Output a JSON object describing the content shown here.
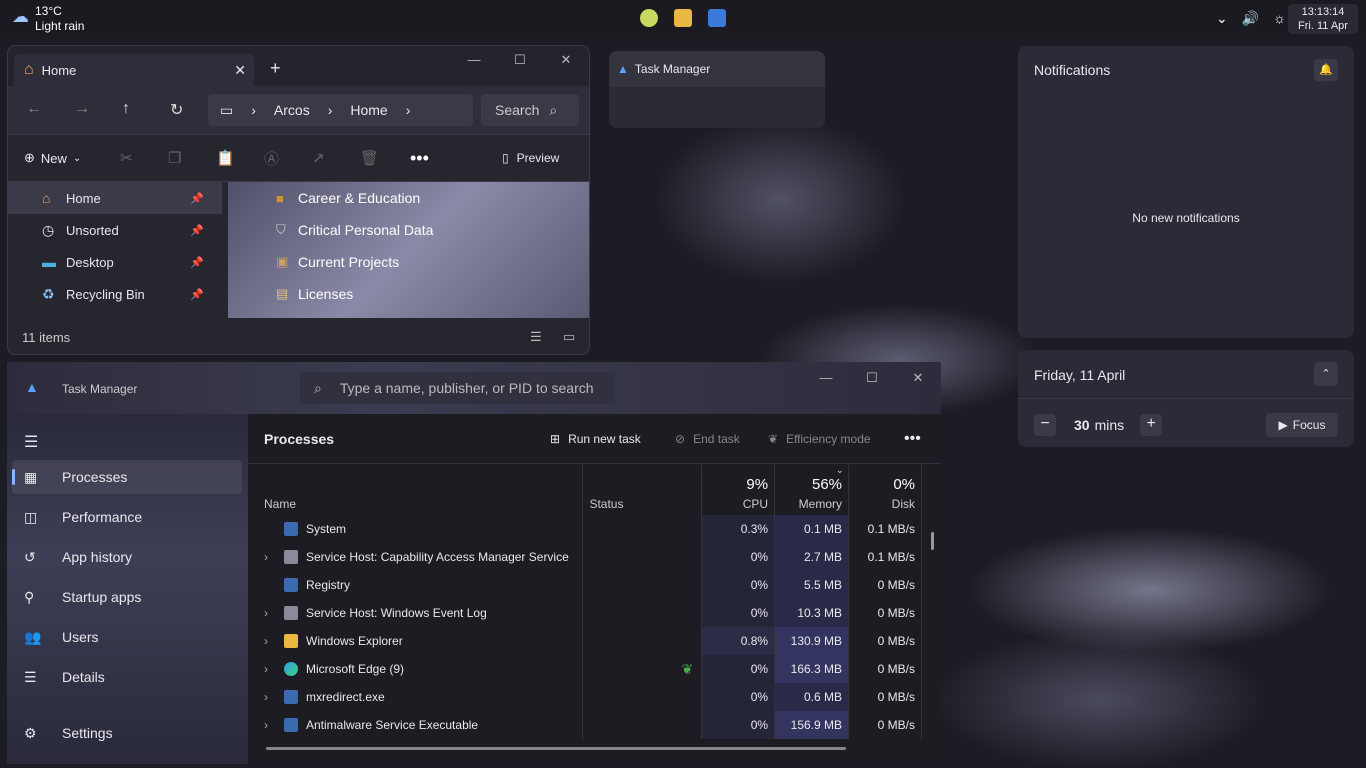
{
  "taskbar": {
    "weather_temp": "13°C",
    "weather_desc": "Light rain",
    "time": "13:13:14",
    "date": "Fri. 11 Apr"
  },
  "explorer": {
    "tab_title": "Home",
    "breadcrumb": [
      "Arcos",
      "Home"
    ],
    "search_placeholder": "Search",
    "new_label": "New",
    "preview_label": "Preview",
    "sidebar": [
      {
        "label": "Home",
        "icon": "home-icon"
      },
      {
        "label": "Unsorted",
        "icon": "clock-icon"
      },
      {
        "label": "Desktop",
        "icon": "desktop-icon"
      },
      {
        "label": "Recycling Bin",
        "icon": "recycle-bin-icon"
      }
    ],
    "folders": [
      {
        "label": "Career & Education",
        "icon": "briefcase-icon"
      },
      {
        "label": "Critical Personal Data",
        "icon": "shield-icon"
      },
      {
        "label": "Current Projects",
        "icon": "box-icon"
      },
      {
        "label": "Licenses",
        "icon": "certificate-icon"
      }
    ],
    "status": "11 items"
  },
  "tm_popup": {
    "title": "Task Manager"
  },
  "notifications": {
    "title": "Notifications",
    "empty": "No new notifications"
  },
  "calendar": {
    "date": "Friday, 11 April",
    "focus_value": "30",
    "focus_unit": "mins",
    "focus_label": "Focus"
  },
  "taskmgr": {
    "title": "Task Manager",
    "search_placeholder": "Type a name, publisher, or PID to search",
    "nav": [
      "Processes",
      "Performance",
      "App history",
      "Startup apps",
      "Users",
      "Details",
      "Settings"
    ],
    "page_title": "Processes",
    "run_new_task": "Run new task",
    "end_task": "End task",
    "efficiency_mode": "Efficiency mode",
    "columns": {
      "name": "Name",
      "status": "Status",
      "cpu": "CPU",
      "cpu_pct": "9%",
      "memory": "Memory",
      "memory_pct": "56%",
      "disk": "Disk",
      "disk_pct": "0%"
    },
    "rows": [
      {
        "name": "System",
        "status": "",
        "cpu": "0.3%",
        "mem": "0.1 MB",
        "disk": "0.1 MB/s"
      },
      {
        "name": "Service Host: Capability Access Manager Service",
        "status": "",
        "cpu": "0%",
        "mem": "2.7 MB",
        "disk": "0.1 MB/s"
      },
      {
        "name": "Registry",
        "status": "",
        "cpu": "0%",
        "mem": "5.5 MB",
        "disk": "0 MB/s"
      },
      {
        "name": "Service Host: Windows Event Log",
        "status": "",
        "cpu": "0%",
        "mem": "10.3 MB",
        "disk": "0 MB/s"
      },
      {
        "name": "Windows Explorer",
        "status": "",
        "cpu": "0.8%",
        "mem": "130.9 MB",
        "disk": "0 MB/s"
      },
      {
        "name": "Microsoft Edge (9)",
        "status": "efficiency-leaf-icon",
        "cpu": "0%",
        "mem": "166.3 MB",
        "disk": "0 MB/s"
      },
      {
        "name": "mxredirect.exe",
        "status": "",
        "cpu": "0%",
        "mem": "0.6 MB",
        "disk": "0 MB/s"
      },
      {
        "name": "Antimalware Service Executable",
        "status": "",
        "cpu": "0%",
        "mem": "156.9 MB",
        "disk": "0 MB/s"
      }
    ]
  }
}
